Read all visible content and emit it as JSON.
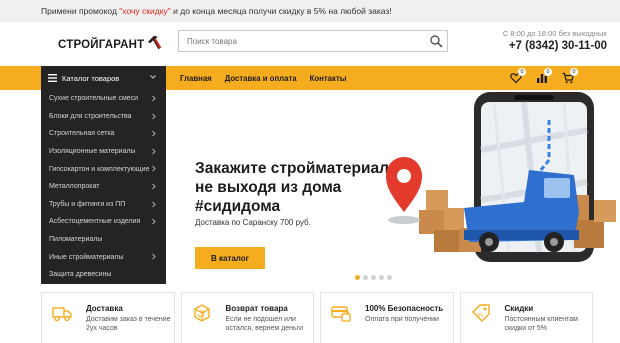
{
  "colors": {
    "accent": "#f5ac1e",
    "dark": "#242424",
    "promo_code": "#e0271a",
    "icon_blue": "#2e6fd0"
  },
  "promo": {
    "prefix": "Примени промокод ",
    "code": "\"хочу скидку\"",
    "suffix": " и до конца месяца получи скидку в 5% на любой заказ!"
  },
  "header": {
    "logo_text": "СТРОЙГАРАНТ",
    "logo_icon": "hammer-icon",
    "search": {
      "placeholder": "Поиск товара",
      "value": ""
    },
    "hours": "С 8:00 до 18:00 без выходных",
    "phone": "+7 (8342) 30-11-00"
  },
  "nav": {
    "catalog_label": "Каталог товаров",
    "links": [
      "Главная",
      "Доставка и оплата",
      "Контакты"
    ],
    "icons": [
      {
        "name": "heart-icon",
        "count": "0"
      },
      {
        "name": "compare-icon",
        "count": "0"
      },
      {
        "name": "cart-icon",
        "count": "0"
      }
    ]
  },
  "categories": [
    {
      "label": "Сухие строительные смеси",
      "has_children": true
    },
    {
      "label": "Блоки для строительства",
      "has_children": true
    },
    {
      "label": "Строительная сетка",
      "has_children": true
    },
    {
      "label": "Изоляционные материалы",
      "has_children": true
    },
    {
      "label": "Гипсокартон и комплектующие",
      "has_children": true
    },
    {
      "label": "Металлопрокат",
      "has_children": true
    },
    {
      "label": "Трубы и фитинги из ПП",
      "has_children": true
    },
    {
      "label": "Асбестоцементные изделия",
      "has_children": true
    },
    {
      "label": "Пиломатериалы",
      "has_children": false
    },
    {
      "label": "Иные стройматериалы",
      "has_children": true
    },
    {
      "label": "Защита древесины",
      "has_children": false
    }
  ],
  "hero": {
    "title_line1": "Закажите стройматериалы",
    "title_line2": "не выходя из дома",
    "title_line3": "#сидидома",
    "subtitle": "Доставка по Саранску 700 руб.",
    "button": "В каталог",
    "slides_total": 5,
    "active_slide": 1
  },
  "features": [
    {
      "icon": "truck-icon",
      "title": "Доставка",
      "text": "Доставим заказ в течение 2ух часов"
    },
    {
      "icon": "return-box-icon",
      "title": "Возврат товара",
      "text": "Если не подошел или остался, вернем деньги"
    },
    {
      "icon": "secure-payment-icon",
      "title": "100% Безопасность",
      "text": "Оплата при получении"
    },
    {
      "icon": "discount-tag-icon",
      "title": "Скидки",
      "text": "Постоянным клиентам скидки от 5%"
    }
  ]
}
